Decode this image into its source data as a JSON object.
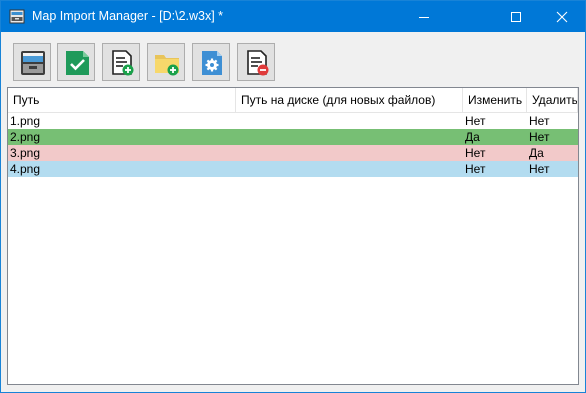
{
  "window": {
    "title": "Map Import Manager - [D:\\2.w3x] *",
    "accent": "#0078d7"
  },
  "titlebar_buttons": [
    "minimize-icon",
    "maximize-icon",
    "close-icon"
  ],
  "toolbar": {
    "buttons": [
      {
        "name": "open-map-button",
        "icon": "archive-drawer-icon"
      },
      {
        "name": "save-apply-button",
        "icon": "green-check-document-icon"
      },
      {
        "name": "add-file-button",
        "icon": "document-add-icon"
      },
      {
        "name": "add-folder-button",
        "icon": "folder-add-icon"
      },
      {
        "name": "file-settings-button",
        "icon": "document-gear-icon"
      },
      {
        "name": "remove-file-button",
        "icon": "document-remove-icon"
      }
    ]
  },
  "table": {
    "columns": [
      "Путь",
      "Путь на диске (для новых файлов)",
      "Изменить",
      "Удалить"
    ],
    "rows": [
      {
        "path": "1.png",
        "disk_path": "",
        "modify": "Нет",
        "delete": "Нет",
        "color": "#ffffff"
      },
      {
        "path": "2.png",
        "disk_path": "",
        "modify": "Да",
        "delete": "Нет",
        "color": "#77bf74"
      },
      {
        "path": "3.png",
        "disk_path": "",
        "modify": "Нет",
        "delete": "Да",
        "color": "#f2c9c9"
      },
      {
        "path": "4.png",
        "disk_path": "",
        "modify": "Нет",
        "delete": "Нет",
        "color": "#b3dcf0"
      }
    ]
  }
}
